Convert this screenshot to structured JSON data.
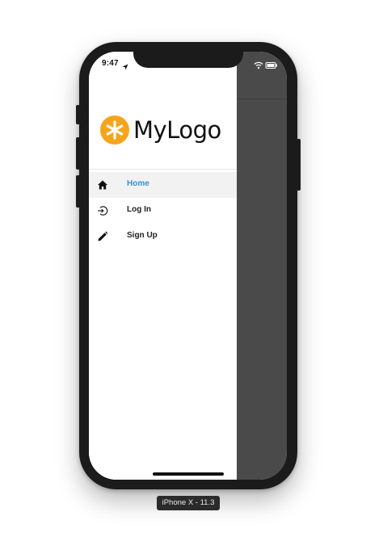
{
  "status_bar": {
    "time": "9:47",
    "location_icon": "location-arrow-icon",
    "wifi_icon": "wifi-icon",
    "battery_icon": "battery-icon"
  },
  "drawer": {
    "logo_text": "MyLogo",
    "logo_icon": "asterisk-icon",
    "logo_color": "#f4a51c",
    "items": [
      {
        "label": "Home",
        "icon": "home-icon",
        "active": true
      },
      {
        "label": "Log In",
        "icon": "login-icon",
        "active": false
      },
      {
        "label": "Sign Up",
        "icon": "pencil-icon",
        "active": false
      }
    ]
  },
  "colors": {
    "active_label": "#3a8fd8",
    "overlay": "#4a4a4a"
  },
  "device_label": "iPhone X - 11.3"
}
